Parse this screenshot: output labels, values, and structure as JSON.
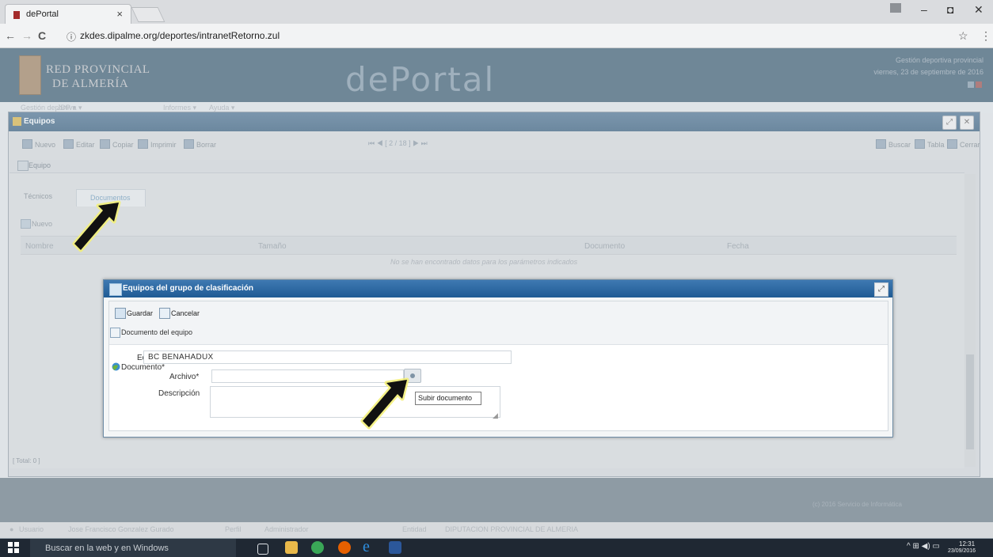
{
  "browser": {
    "tab_title": "dePortal",
    "tab_close": "×",
    "url_info_icon": "ⓘ",
    "url": "zkdes.dipalme.org/deportes/intranetRetorno.zul",
    "back": "←",
    "forward": "→",
    "reload": "C",
    "star": "☆",
    "menu": "⋮",
    "win_minimize": "–",
    "win_restore": "◘",
    "win_close": "✕"
  },
  "header": {
    "brand_line1": "RED PROVINCIAL",
    "brand_line2": "DE ALMERÍA",
    "title": "dePortal",
    "right_line1": "Gestión deportiva provincial",
    "right_line2": "viernes, 23 de septiembre de 2016"
  },
  "menubar": {
    "items": [
      "Gestión deportiva ▾",
      "JDP ▾",
      "Informes ▾",
      "Ayuda ▾"
    ]
  },
  "equipos_window": {
    "title": "Equipos",
    "maximize": "⤢",
    "close": "✕",
    "toolbar": [
      "Nuevo",
      "Editar",
      "Copiar",
      "Imprimir",
      "Borrar"
    ],
    "toolbar_right": [
      "Buscar",
      "Tabla",
      "Cerrar"
    ],
    "pager": "⏮   ◀  [ 2 / 18 ]  ▶   ⏭",
    "form_label": "Equipo",
    "tabs": [
      "Técnicos",
      "Documentos"
    ],
    "new_button": "Nuevo",
    "columns": [
      "Nombre",
      "Tamaño",
      "Documento",
      "Fecha"
    ],
    "empty_message": "No se han encontrado datos para los parámetros indicados",
    "total": "[ Total: 0 ]"
  },
  "dialog": {
    "title": "Equipos del grupo de clasificación",
    "maximize": "⤢",
    "save": "Guardar",
    "cancel": "Cancelar",
    "fieldset": "Documento del equipo",
    "equipo_label": "Equipo*",
    "equipo_value": "BC BENAHADUX",
    "documento_label": "Documento*",
    "archivo_label": "Archivo*",
    "archivo_value": "",
    "descripcion_label": "Descripción",
    "descripcion_value": "",
    "upload_tooltip": "Subir documento"
  },
  "footer": {
    "copyright": "(c) 2016 Servicio de Informática",
    "usuario_label": "Usuario",
    "usuario_value": "Jose Francisco Gonzalez Gurado",
    "perfil_label": "Perfil",
    "perfil_value": "Administrador",
    "entidad_label": "Entidad",
    "entidad_value": "DIPUTACION PROVINCIAL DE ALMERIA"
  },
  "taskbar": {
    "search_placeholder": "Buscar en la web y en Windows",
    "time": "12:31",
    "date": "23/09/2016",
    "tray": "^ ⊞ ◀) ▭"
  },
  "colors": {
    "dialog_titlebar": "#1f5b94",
    "annotation_arrow": "#f3f07a"
  }
}
